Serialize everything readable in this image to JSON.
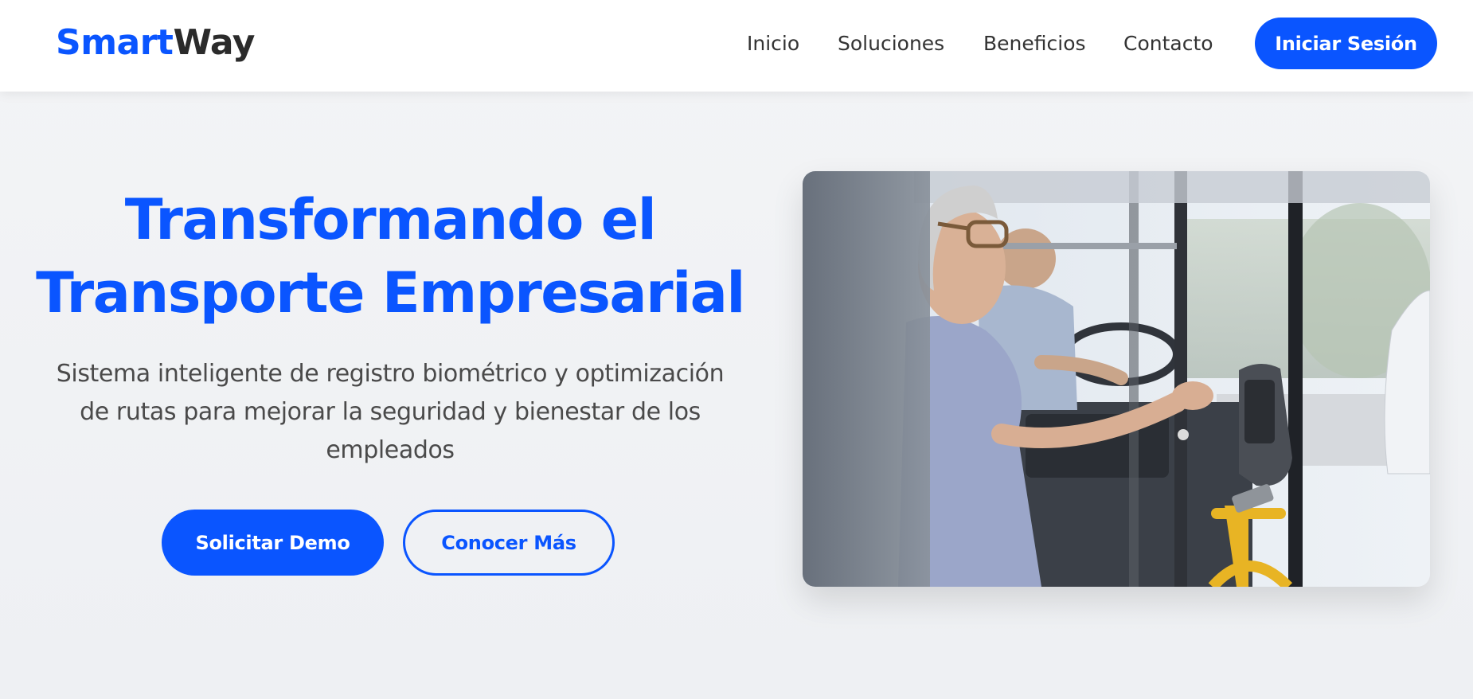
{
  "navbar": {
    "logo": {
      "part1": "Smart",
      "part2": "Way"
    },
    "links": [
      {
        "label": "Inicio"
      },
      {
        "label": "Soluciones"
      },
      {
        "label": "Beneficios"
      },
      {
        "label": "Contacto"
      }
    ],
    "login_label": "Iniciar Sesión"
  },
  "hero": {
    "title_line1": "Transformando el",
    "title_line2": "Transporte Empresarial",
    "subtitle_line1": "Sistema inteligente de registro biométrico y optimización",
    "subtitle_line2": "de rutas para mejorar la seguridad y bienestar de los",
    "subtitle_line3": "empleados",
    "primary_button": "Solicitar Demo",
    "secondary_button": "Conocer Más"
  },
  "colors": {
    "brand": "#0a55ff",
    "text_dark": "#333333",
    "background": "#f3f4f6"
  },
  "image": {
    "icon": "photo-woman-tapping-card-on-bus"
  }
}
